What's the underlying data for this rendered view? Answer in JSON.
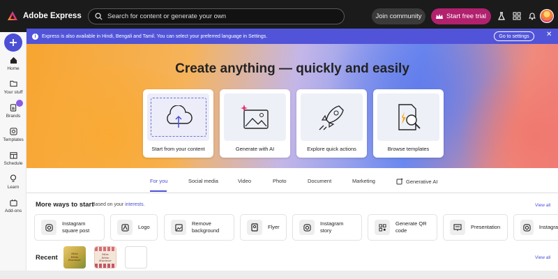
{
  "app": {
    "name": "Adobe Express"
  },
  "topbar": {
    "search_placeholder": "Search for content or generate your own",
    "join_label": "Join community",
    "trial_label": "Start free trial",
    "icons": [
      "lab-flask-icon",
      "apps-grid-icon",
      "bell-icon"
    ]
  },
  "sidebar": {
    "create_icon": "plus-icon",
    "items": [
      {
        "label": "Home",
        "icon": "home-icon"
      },
      {
        "label": "Your stuff",
        "icon": "folder-icon"
      },
      {
        "label": "Brands",
        "icon": "brand-icon"
      },
      {
        "label": "Templates",
        "icon": "templates-icon"
      },
      {
        "label": "Schedule",
        "icon": "calendar-icon"
      },
      {
        "label": "Learn",
        "icon": "lightbulb-icon"
      },
      {
        "label": "Add-ons",
        "icon": "addons-icon"
      }
    ]
  },
  "banner": {
    "message": "Express is also available in Hindi, Bengali and Tamil. You can select your preferred language in Settings.",
    "button": "Go to settings"
  },
  "hero": {
    "title": "Create anything — quickly and easily",
    "cards": [
      {
        "label": "Start from your content",
        "icon": "cloud-upload-icon"
      },
      {
        "label": "Generate with AI",
        "icon": "ai-image-icon"
      },
      {
        "label": "Explore quick actions",
        "icon": "rocket-icon"
      },
      {
        "label": "Browse templates",
        "icon": "template-search-icon"
      }
    ]
  },
  "tabs": [
    {
      "label": "For you",
      "active": true
    },
    {
      "label": "Social media"
    },
    {
      "label": "Video"
    },
    {
      "label": "Photo"
    },
    {
      "label": "Document"
    },
    {
      "label": "Marketing"
    },
    {
      "label": "Generative AI"
    }
  ],
  "more_ways": {
    "title": "More ways to start",
    "subtitle_prefix": "Based on your",
    "subtitle_link": "interests.",
    "view_all": "View all",
    "items": [
      {
        "label": "Instagram\nsquare post",
        "icon": "instagram-icon"
      },
      {
        "label": "Logo",
        "icon": "logo-icon"
      },
      {
        "label": "Remove\nbackground",
        "icon": "remove-bg-icon"
      },
      {
        "label": "Flyer",
        "icon": "flyer-icon"
      },
      {
        "label": "Instagram\nstory",
        "icon": "instagram-icon"
      },
      {
        "label": "Generate QR\ncode",
        "icon": "qr-code-icon"
      },
      {
        "label": "Presentation",
        "icon": "presentation-icon"
      },
      {
        "label": "Instagra",
        "icon": "instagram-icon"
      }
    ]
  },
  "recent": {
    "title": "Recent",
    "view_all": "View all",
    "thumb_text": [
      "Miss\nWrite\nHummer",
      "Miss\nWrite\nHummer"
    ]
  },
  "colors": {
    "accent": "#4b4fd6",
    "trial": "#b2216e",
    "topbar": "#1b1b1b"
  }
}
